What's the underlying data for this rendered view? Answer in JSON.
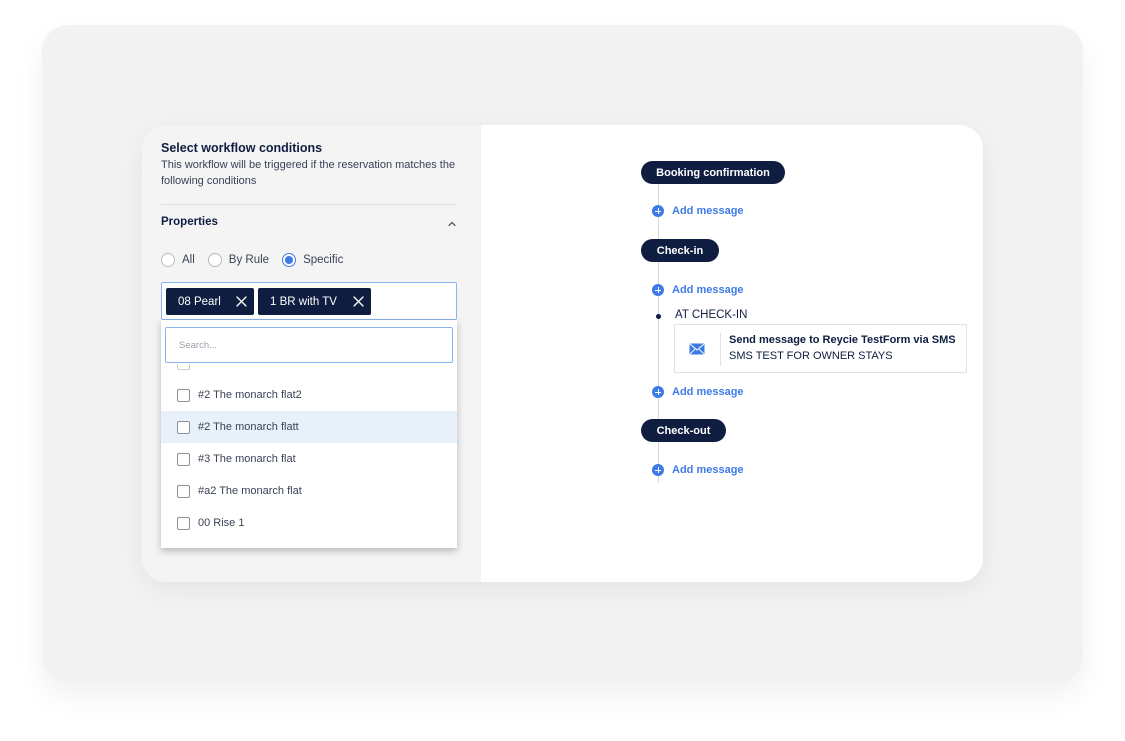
{
  "conditions": {
    "title": "Select workflow conditions",
    "subtitle": "This workflow will be triggered if the reservation matches the following conditions",
    "properties_label": "Properties",
    "radio": {
      "all": "All",
      "by_rule": "By Rule",
      "specific": "Specific",
      "selected": "Specific"
    },
    "selected_tags": [
      "08 Pearl",
      "1 BR with TV"
    ],
    "search_placeholder": "Search...",
    "list_items": [
      {
        "label": "#2 The monarch flat2",
        "checked": false,
        "highlighted": false
      },
      {
        "label": "#2 The monarch flatt",
        "checked": false,
        "highlighted": true
      },
      {
        "label": "#3 The monarch flat",
        "checked": false,
        "highlighted": false
      },
      {
        "label": "#a2 The monarch flat",
        "checked": false,
        "highlighted": false
      },
      {
        "label": "00 Rise 1",
        "checked": false,
        "highlighted": false
      }
    ]
  },
  "workflow": {
    "stages": [
      "Booking confirmation",
      "Check-in",
      "Check-out"
    ],
    "add_message_label": "Add message",
    "trigger_label": "AT CHECK-IN",
    "message": {
      "title": "Send message to Reycie TestForm via SMS",
      "subtitle": "SMS TEST FOR OWNER STAYS"
    }
  },
  "colors": {
    "navy": "#0f1d40",
    "accent_blue": "#3e7ae6",
    "highlight_row": "#e8f0fa",
    "panel_gray": "#f4f4f5"
  }
}
